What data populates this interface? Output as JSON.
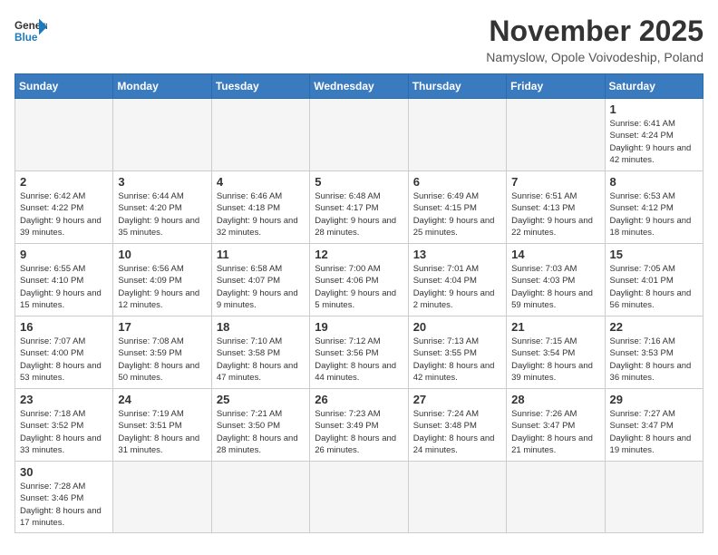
{
  "header": {
    "logo_general": "General",
    "logo_blue": "Blue",
    "title": "November 2025",
    "subtitle": "Namyslow, Opole Voivodeship, Poland"
  },
  "weekdays": [
    "Sunday",
    "Monday",
    "Tuesday",
    "Wednesday",
    "Thursday",
    "Friday",
    "Saturday"
  ],
  "weeks": [
    [
      {
        "day": "",
        "info": ""
      },
      {
        "day": "",
        "info": ""
      },
      {
        "day": "",
        "info": ""
      },
      {
        "day": "",
        "info": ""
      },
      {
        "day": "",
        "info": ""
      },
      {
        "day": "",
        "info": ""
      },
      {
        "day": "1",
        "info": "Sunrise: 6:41 AM\nSunset: 4:24 PM\nDaylight: 9 hours and 42 minutes."
      }
    ],
    [
      {
        "day": "2",
        "info": "Sunrise: 6:42 AM\nSunset: 4:22 PM\nDaylight: 9 hours and 39 minutes."
      },
      {
        "day": "3",
        "info": "Sunrise: 6:44 AM\nSunset: 4:20 PM\nDaylight: 9 hours and 35 minutes."
      },
      {
        "day": "4",
        "info": "Sunrise: 6:46 AM\nSunset: 4:18 PM\nDaylight: 9 hours and 32 minutes."
      },
      {
        "day": "5",
        "info": "Sunrise: 6:48 AM\nSunset: 4:17 PM\nDaylight: 9 hours and 28 minutes."
      },
      {
        "day": "6",
        "info": "Sunrise: 6:49 AM\nSunset: 4:15 PM\nDaylight: 9 hours and 25 minutes."
      },
      {
        "day": "7",
        "info": "Sunrise: 6:51 AM\nSunset: 4:13 PM\nDaylight: 9 hours and 22 minutes."
      },
      {
        "day": "8",
        "info": "Sunrise: 6:53 AM\nSunset: 4:12 PM\nDaylight: 9 hours and 18 minutes."
      }
    ],
    [
      {
        "day": "9",
        "info": "Sunrise: 6:55 AM\nSunset: 4:10 PM\nDaylight: 9 hours and 15 minutes."
      },
      {
        "day": "10",
        "info": "Sunrise: 6:56 AM\nSunset: 4:09 PM\nDaylight: 9 hours and 12 minutes."
      },
      {
        "day": "11",
        "info": "Sunrise: 6:58 AM\nSunset: 4:07 PM\nDaylight: 9 hours and 9 minutes."
      },
      {
        "day": "12",
        "info": "Sunrise: 7:00 AM\nSunset: 4:06 PM\nDaylight: 9 hours and 5 minutes."
      },
      {
        "day": "13",
        "info": "Sunrise: 7:01 AM\nSunset: 4:04 PM\nDaylight: 9 hours and 2 minutes."
      },
      {
        "day": "14",
        "info": "Sunrise: 7:03 AM\nSunset: 4:03 PM\nDaylight: 8 hours and 59 minutes."
      },
      {
        "day": "15",
        "info": "Sunrise: 7:05 AM\nSunset: 4:01 PM\nDaylight: 8 hours and 56 minutes."
      }
    ],
    [
      {
        "day": "16",
        "info": "Sunrise: 7:07 AM\nSunset: 4:00 PM\nDaylight: 8 hours and 53 minutes."
      },
      {
        "day": "17",
        "info": "Sunrise: 7:08 AM\nSunset: 3:59 PM\nDaylight: 8 hours and 50 minutes."
      },
      {
        "day": "18",
        "info": "Sunrise: 7:10 AM\nSunset: 3:58 PM\nDaylight: 8 hours and 47 minutes."
      },
      {
        "day": "19",
        "info": "Sunrise: 7:12 AM\nSunset: 3:56 PM\nDaylight: 8 hours and 44 minutes."
      },
      {
        "day": "20",
        "info": "Sunrise: 7:13 AM\nSunset: 3:55 PM\nDaylight: 8 hours and 42 minutes."
      },
      {
        "day": "21",
        "info": "Sunrise: 7:15 AM\nSunset: 3:54 PM\nDaylight: 8 hours and 39 minutes."
      },
      {
        "day": "22",
        "info": "Sunrise: 7:16 AM\nSunset: 3:53 PM\nDaylight: 8 hours and 36 minutes."
      }
    ],
    [
      {
        "day": "23",
        "info": "Sunrise: 7:18 AM\nSunset: 3:52 PM\nDaylight: 8 hours and 33 minutes."
      },
      {
        "day": "24",
        "info": "Sunrise: 7:19 AM\nSunset: 3:51 PM\nDaylight: 8 hours and 31 minutes."
      },
      {
        "day": "25",
        "info": "Sunrise: 7:21 AM\nSunset: 3:50 PM\nDaylight: 8 hours and 28 minutes."
      },
      {
        "day": "26",
        "info": "Sunrise: 7:23 AM\nSunset: 3:49 PM\nDaylight: 8 hours and 26 minutes."
      },
      {
        "day": "27",
        "info": "Sunrise: 7:24 AM\nSunset: 3:48 PM\nDaylight: 8 hours and 24 minutes."
      },
      {
        "day": "28",
        "info": "Sunrise: 7:26 AM\nSunset: 3:47 PM\nDaylight: 8 hours and 21 minutes."
      },
      {
        "day": "29",
        "info": "Sunrise: 7:27 AM\nSunset: 3:47 PM\nDaylight: 8 hours and 19 minutes."
      }
    ],
    [
      {
        "day": "30",
        "info": "Sunrise: 7:28 AM\nSunset: 3:46 PM\nDaylight: 8 hours and 17 minutes."
      },
      {
        "day": "",
        "info": ""
      },
      {
        "day": "",
        "info": ""
      },
      {
        "day": "",
        "info": ""
      },
      {
        "day": "",
        "info": ""
      },
      {
        "day": "",
        "info": ""
      },
      {
        "day": "",
        "info": ""
      }
    ]
  ]
}
